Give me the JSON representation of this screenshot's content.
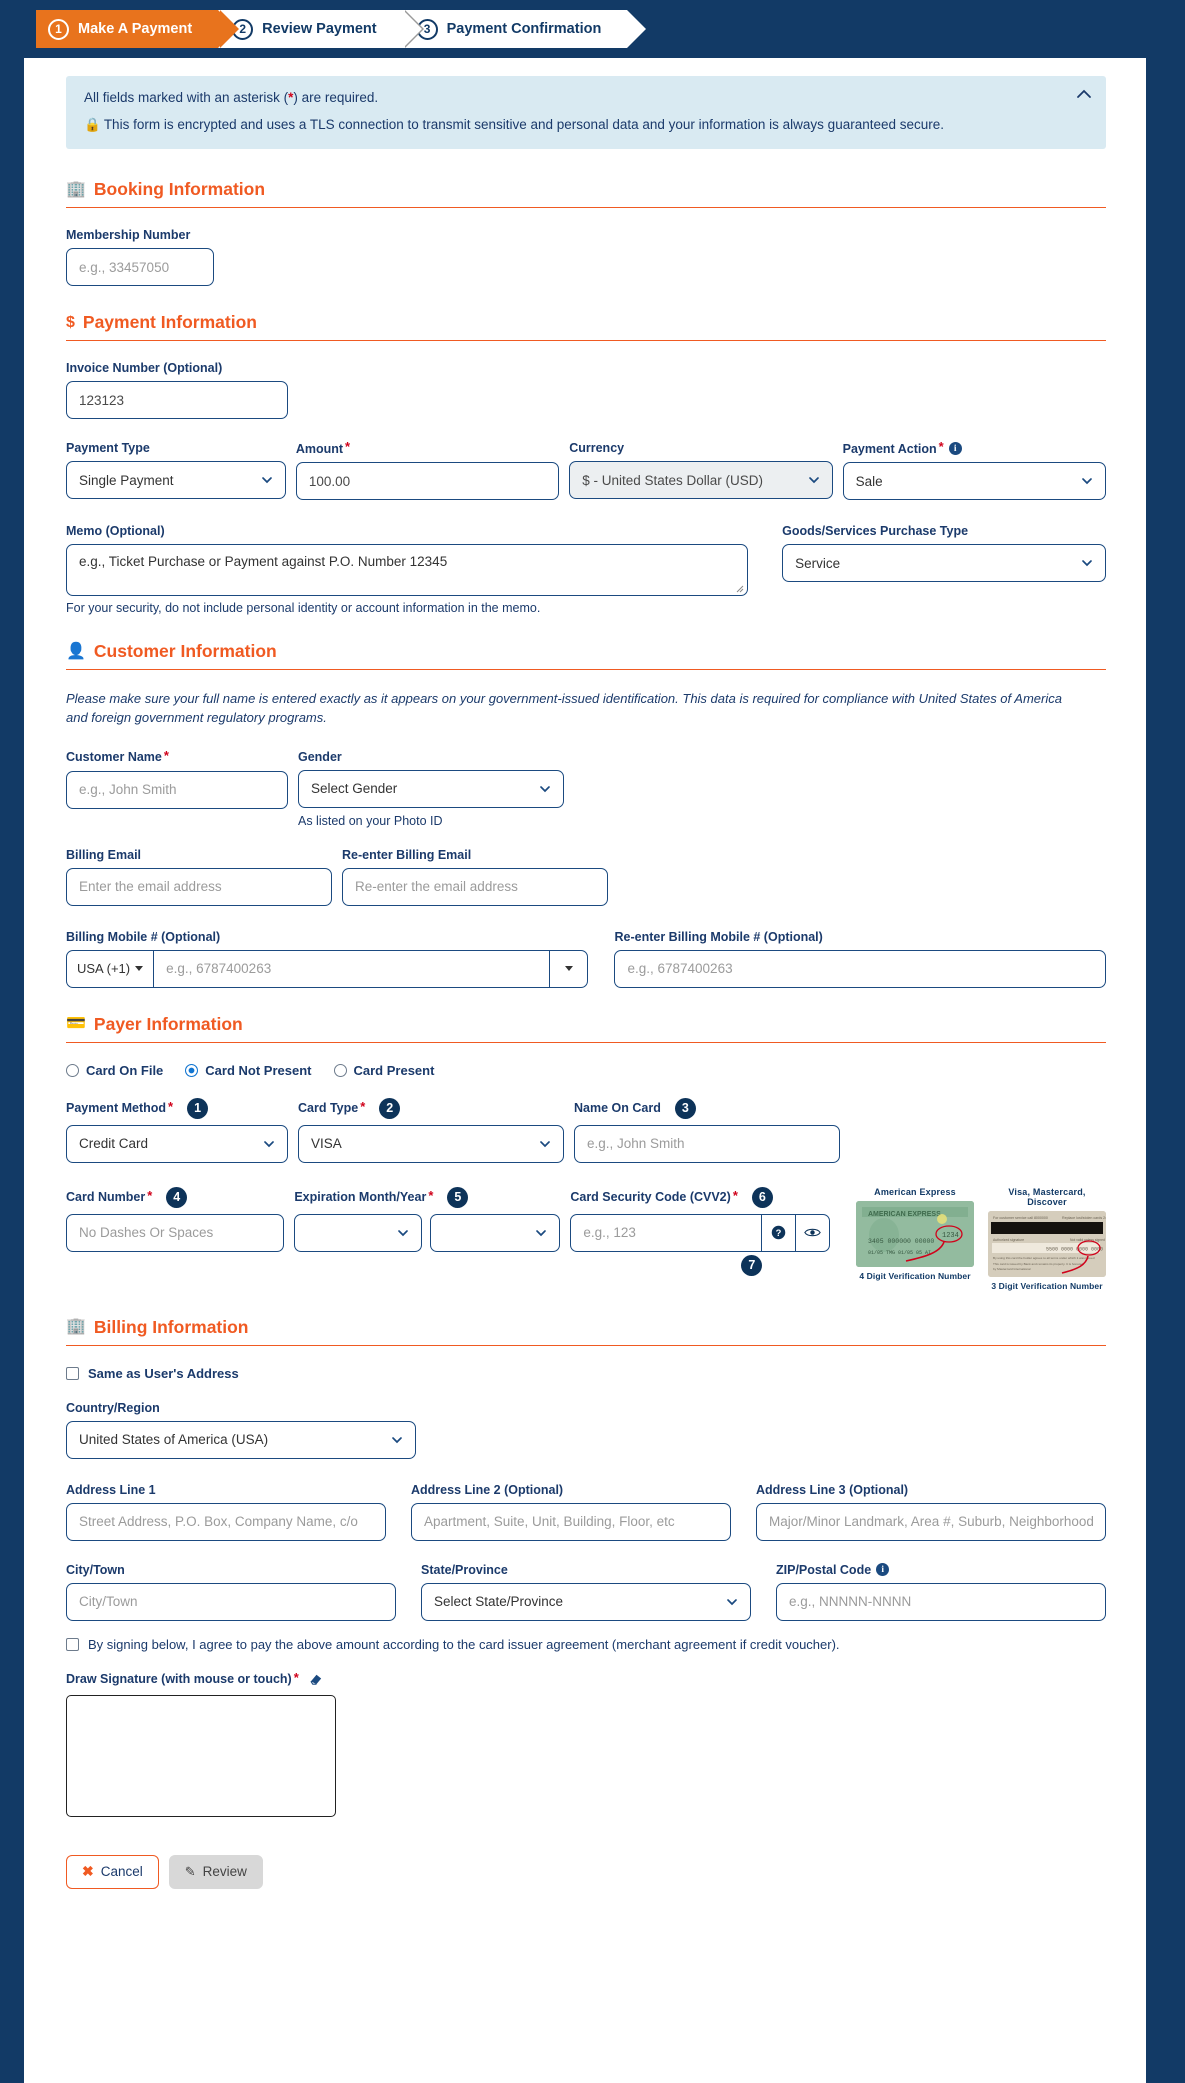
{
  "stepper": {
    "steps": [
      {
        "num": "1",
        "label": "Make A Payment",
        "active": true
      },
      {
        "num": "2",
        "label": "Review Payment",
        "active": false
      },
      {
        "num": "3",
        "label": "Payment Confirmation",
        "active": false
      }
    ]
  },
  "notice": {
    "required_text_before": "All fields marked with an asterisk (",
    "required_star": "*",
    "required_text_after": ") are required.",
    "security_text": "This form is encrypted and uses a TLS connection to transmit sensitive and personal data and your information is always guaranteed secure.",
    "lock_icon": "lock-icon",
    "collapse_icon": "chevron-up-icon"
  },
  "booking": {
    "title": "Booking Information",
    "icon": "building-icon",
    "membership_label": "Membership Number",
    "membership_placeholder": "e.g., 33457050"
  },
  "payment": {
    "title": "Payment Information",
    "icon": "dollar-icon",
    "invoice_label": "Invoice Number (Optional)",
    "invoice_value": "123123",
    "payment_type_label": "Payment Type",
    "payment_type_value": "Single Payment",
    "amount_label": "Amount",
    "amount_value": "100.00",
    "currency_label": "Currency",
    "currency_value": "$ - United States Dollar (USD)",
    "payment_action_label": "Payment Action",
    "payment_action_value": "Sale",
    "memo_label": "Memo (Optional)",
    "memo_placeholder": "e.g., Ticket Purchase or Payment against P.O. Number 12345",
    "memo_note": "For your security, do not include personal identity or account information in the memo.",
    "goods_label": "Goods/Services Purchase Type",
    "goods_value": "Service"
  },
  "customer": {
    "title": "Customer Information",
    "icon": "person-icon",
    "note": "Please make sure your full name is entered exactly as it appears on your government-issued identification. This data is required for compliance with United States of America and foreign government regulatory programs.",
    "name_label": "Customer Name",
    "name_placeholder": "e.g., John Smith",
    "gender_label": "Gender",
    "gender_value": "Select Gender",
    "gender_help": "As listed on your Photo ID",
    "email_label": "Billing Email",
    "email_placeholder": "Enter the email address",
    "email2_label": "Re-enter Billing Email",
    "email2_placeholder": "Re-enter the email address",
    "mobile_label": "Billing Mobile # (Optional)",
    "mobile_country": "USA (+1)",
    "mobile_placeholder": "e.g., 6787400263",
    "mobile2_label": "Re-enter Billing Mobile # (Optional)",
    "mobile2_placeholder": "e.g., 6787400263"
  },
  "payer": {
    "title": "Payer Information",
    "icon": "credit-card-icon",
    "radios": [
      {
        "label": "Card On File",
        "selected": false
      },
      {
        "label": "Card Not Present",
        "selected": true
      },
      {
        "label": "Card Present",
        "selected": false
      }
    ],
    "payment_method_label": "Payment Method",
    "payment_method_value": "Credit Card",
    "payment_method_badge": "1",
    "card_type_label": "Card Type",
    "card_type_value": "VISA",
    "card_type_badge": "2",
    "name_on_card_label": "Name On Card",
    "name_on_card_placeholder": "e.g., John Smith",
    "name_on_card_badge": "3",
    "card_number_label": "Card Number",
    "card_number_placeholder": "No Dashes Or Spaces",
    "card_number_badge": "4",
    "expiration_label": "Expiration Month/Year",
    "expiration_badge": "5",
    "exp_month_value": "",
    "exp_year_value": "",
    "cvv_label": "Card Security Code (CVV2)",
    "cvv_placeholder": "e.g., 123",
    "cvv_badge": "6",
    "cvv_help_icon": "question-circle-icon",
    "cvv_eye_icon": "eye-icon",
    "cvv_eye_badge": "7",
    "card_art": [
      {
        "title": "American Express",
        "caption": "4 Digit Verification Number",
        "sample": "1234"
      },
      {
        "title": "Visa, Mastercard, Discover",
        "caption": "3 Digit Verification Number",
        "sample": "123"
      }
    ]
  },
  "billing": {
    "title": "Billing Information",
    "icon": "building-icon",
    "same_address_label": "Same as User's Address",
    "country_label": "Country/Region",
    "country_value": "United States of America (USA)",
    "addr1_label": "Address Line 1",
    "addr1_placeholder": "Street Address, P.O. Box, Company Name, c/o",
    "addr2_label": "Address Line 2 (Optional)",
    "addr2_placeholder": "Apartment, Suite, Unit, Building, Floor, etc",
    "addr3_label": "Address Line 3 (Optional)",
    "addr3_placeholder": "Major/Minor Landmark, Area #, Suburb, Neighborhood",
    "city_label": "City/Town",
    "city_placeholder": "City/Town",
    "state_label": "State/Province",
    "state_value": "Select State/Province",
    "zip_label": "ZIP/Postal Code",
    "zip_placeholder": "e.g., NNNNN-NNNN",
    "zip_info_icon": "info-circle-icon",
    "agree_label": "By signing below, I agree to pay the above amount according to the card issuer agreement (merchant agreement if credit voucher).",
    "signature_label": "Draw Signature (with mouse or touch)",
    "signature_erase_icon": "eraser-icon"
  },
  "footer": {
    "cancel_label": "Cancel",
    "cancel_icon": "x-icon",
    "review_label": "Review",
    "review_icon": "pencil-icon"
  },
  "colors": {
    "brand_navy": "#123a66",
    "accent_orange": "#f05a22",
    "step_orange": "#e8731d",
    "notice_blue": "#d9eaf2",
    "required_red": "#d0021b",
    "radio_blue": "#1175d1"
  }
}
